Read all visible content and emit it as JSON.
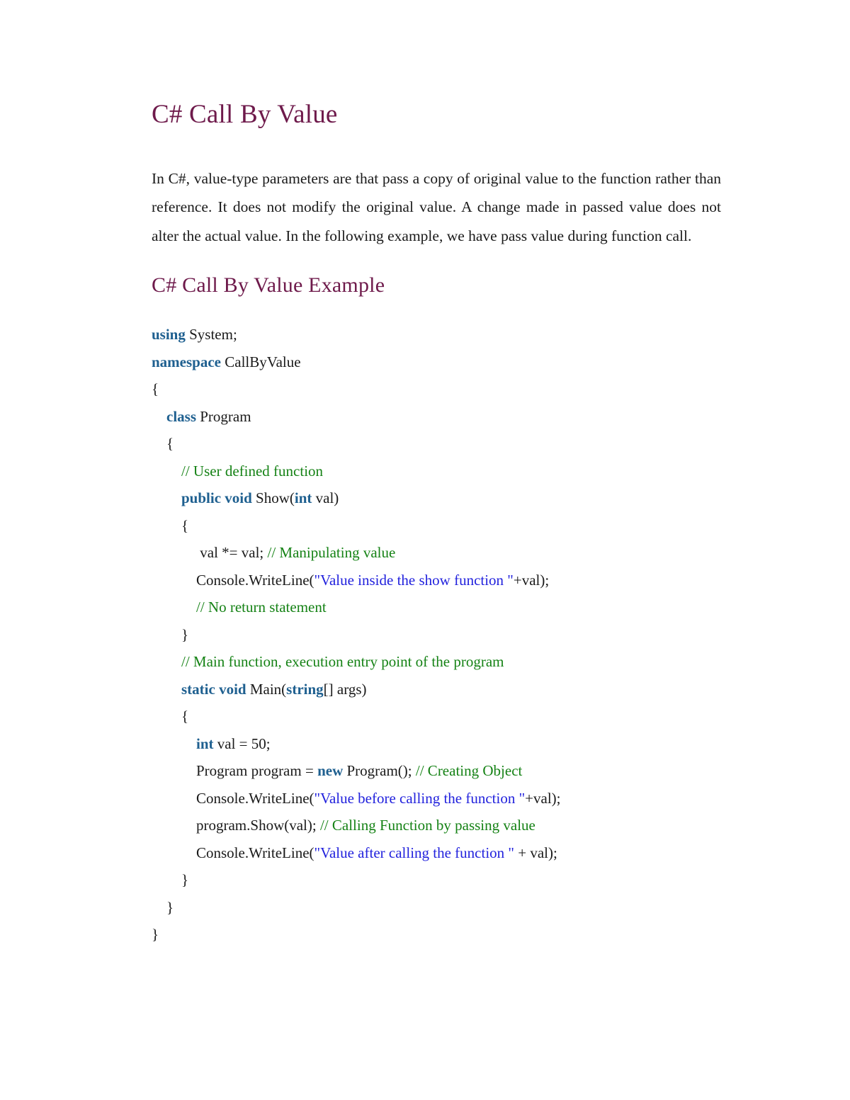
{
  "document": {
    "title": "C# Call By Value",
    "intro_paragraph": "In C#, value-type parameters are that pass a copy of original value to the function rather than reference. It does not modify the original value. A change made in passed value does not alter the actual value. In the following example, we have pass value during function call.",
    "example_heading": "C# Call By Value Example"
  },
  "colors": {
    "heading": "#6e1a4b",
    "keyword": "#1f6090",
    "string": "#2222dd",
    "comment": "#158215",
    "body_text": "#1a1a1a",
    "page_background": "#ffffff"
  },
  "code": {
    "language": "csharp",
    "lines": [
      {
        "indent": 0,
        "tokens": [
          {
            "t": "kw",
            "v": "using"
          },
          {
            "t": "plain",
            "v": " System;"
          }
        ]
      },
      {
        "indent": 0,
        "tokens": [
          {
            "t": "kw",
            "v": "namespace"
          },
          {
            "t": "plain",
            "v": " CallByValue"
          }
        ]
      },
      {
        "indent": 0,
        "tokens": [
          {
            "t": "plain",
            "v": "{"
          }
        ]
      },
      {
        "indent": 1,
        "tokens": [
          {
            "t": "kw",
            "v": "class"
          },
          {
            "t": "plain",
            "v": " Program"
          }
        ]
      },
      {
        "indent": 1,
        "tokens": [
          {
            "t": "plain",
            "v": "{"
          }
        ]
      },
      {
        "indent": 2,
        "tokens": [
          {
            "t": "cmt",
            "v": "// User defined function"
          }
        ]
      },
      {
        "indent": 2,
        "tokens": [
          {
            "t": "kw",
            "v": "public void"
          },
          {
            "t": "plain",
            "v": " Show("
          },
          {
            "t": "kw",
            "v": "int"
          },
          {
            "t": "plain",
            "v": " val)"
          }
        ]
      },
      {
        "indent": 2,
        "tokens": [
          {
            "t": "plain",
            "v": "{"
          }
        ]
      },
      {
        "indent": 3,
        "tokens": [
          {
            "t": "plain",
            "v": " val *= val; "
          },
          {
            "t": "cmt",
            "v": "// Manipulating value"
          }
        ]
      },
      {
        "indent": 3,
        "tokens": [
          {
            "t": "plain",
            "v": "Console.WriteLine("
          },
          {
            "t": "str",
            "v": "\"Value inside the show function \""
          },
          {
            "t": "plain",
            "v": "+val);"
          }
        ]
      },
      {
        "indent": 3,
        "tokens": [
          {
            "t": "cmt",
            "v": "// No return statement"
          }
        ]
      },
      {
        "indent": 2,
        "tokens": [
          {
            "t": "plain",
            "v": "}"
          }
        ]
      },
      {
        "indent": 2,
        "tokens": [
          {
            "t": "cmt",
            "v": "// Main function, execution entry point of the program"
          }
        ]
      },
      {
        "indent": 2,
        "tokens": [
          {
            "t": "kw",
            "v": "static void"
          },
          {
            "t": "plain",
            "v": " Main("
          },
          {
            "t": "kw",
            "v": "string"
          },
          {
            "t": "plain",
            "v": "[] args)"
          }
        ]
      },
      {
        "indent": 2,
        "tokens": [
          {
            "t": "plain",
            "v": "{"
          }
        ]
      },
      {
        "indent": 3,
        "tokens": [
          {
            "t": "kw",
            "v": "int"
          },
          {
            "t": "plain",
            "v": " val = 50;"
          }
        ]
      },
      {
        "indent": 3,
        "tokens": [
          {
            "t": "plain",
            "v": "Program program = "
          },
          {
            "t": "kw",
            "v": "new"
          },
          {
            "t": "plain",
            "v": " Program(); "
          },
          {
            "t": "cmt",
            "v": "// Creating Object"
          }
        ]
      },
      {
        "indent": 3,
        "tokens": [
          {
            "t": "plain",
            "v": "Console.WriteLine("
          },
          {
            "t": "str",
            "v": "\"Value before calling the function \""
          },
          {
            "t": "plain",
            "v": "+val);"
          }
        ]
      },
      {
        "indent": 3,
        "tokens": [
          {
            "t": "plain",
            "v": "program.Show(val); "
          },
          {
            "t": "cmt",
            "v": "// Calling Function by passing value"
          }
        ]
      },
      {
        "indent": 3,
        "tokens": [
          {
            "t": "plain",
            "v": "Console.WriteLine("
          },
          {
            "t": "str",
            "v": "\"Value after calling the function \""
          },
          {
            "t": "plain",
            "v": " + val);"
          }
        ]
      },
      {
        "indent": 2,
        "tokens": [
          {
            "t": "plain",
            "v": "}"
          }
        ]
      },
      {
        "indent": 1,
        "tokens": [
          {
            "t": "plain",
            "v": "}"
          }
        ]
      },
      {
        "indent": 0,
        "tokens": [
          {
            "t": "plain",
            "v": "}"
          }
        ]
      }
    ]
  }
}
